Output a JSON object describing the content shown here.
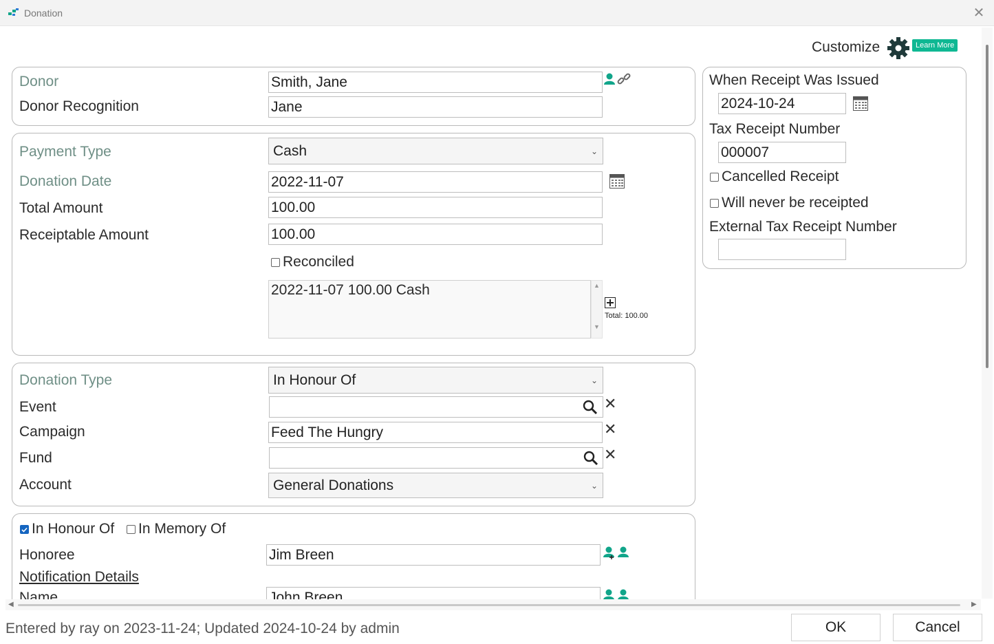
{
  "window": {
    "title": "Donation",
    "close_icon": "close-icon"
  },
  "customize": {
    "label": "Customize",
    "learn_more": "Learn More"
  },
  "donor": {
    "donor_label": "Donor",
    "donor_value": "Smith, Jane",
    "recognition_label": "Donor Recognition",
    "recognition_value": "Jane"
  },
  "payment": {
    "payment_type_label": "Payment Type",
    "payment_type_value": "Cash",
    "donation_date_label": "Donation Date",
    "donation_date_value": "2022-11-07",
    "total_amount_label": "Total Amount",
    "total_amount_value": "100.00",
    "receiptable_label": "Receiptable Amount",
    "receiptable_value": "100.00",
    "reconciled_label": "Reconciled",
    "payments_list": [
      "2022-11-07 100.00 Cash"
    ],
    "total_text": "Total: 100.00"
  },
  "donation": {
    "type_label": "Donation Type",
    "type_value": "In Honour Of",
    "event_label": "Event",
    "event_value": "",
    "campaign_label": "Campaign",
    "campaign_value": "Feed The Hungry",
    "fund_label": "Fund",
    "fund_value": "",
    "account_label": "Account",
    "account_value": "General Donations"
  },
  "tribute": {
    "honour_label": "In Honour Of",
    "honour_checked": true,
    "memory_label": "In Memory Of",
    "memory_checked": false,
    "honoree_label": "Honoree",
    "honoree_value": "Jim Breen",
    "notification_label": "Notification Details",
    "name_label": "Name",
    "name_value": "John Breen"
  },
  "receipt": {
    "issued_label": "When Receipt Was Issued",
    "issued_value": "2024-10-24",
    "tax_number_label": "Tax Receipt Number",
    "tax_number_value": "000007",
    "cancelled_label": "Cancelled Receipt",
    "never_label": "Will never be receipted",
    "external_label": "External Tax Receipt Number",
    "external_value": ""
  },
  "footer": {
    "status": "Entered by ray on 2023-11-24; Updated 2024-10-24 by admin",
    "ok": "OK",
    "cancel": "Cancel"
  },
  "colors": {
    "accent": "#11a58a",
    "required_label": "#6f8f86",
    "checkbox": "#1565c0"
  }
}
